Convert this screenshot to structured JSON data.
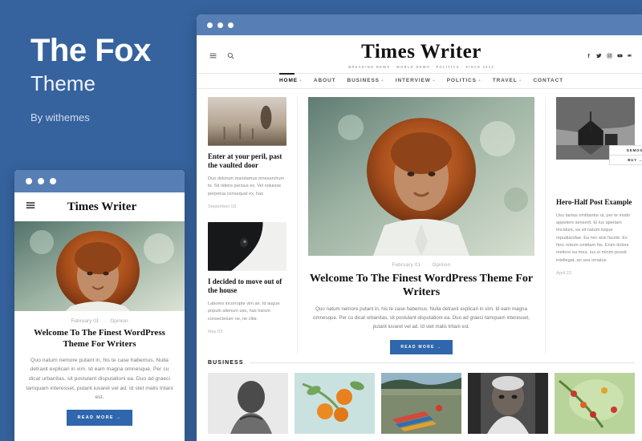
{
  "promo": {
    "title": "The Fox",
    "subtitle": "Theme",
    "author": "By withemes",
    "background_color": "#36639e"
  },
  "browser": {
    "accent_color": "#2f66ad",
    "titlebar_color": "#587fb5",
    "dots": [
      "close",
      "minimize",
      "maximize"
    ]
  },
  "site": {
    "brand": "Times Writer",
    "tagline": "BREAKING NEWS · WORLD NEWS · POLITICS · SINCE 2012",
    "header_icons": [
      {
        "name": "hamburger-menu-icon",
        "label": "Menu"
      },
      {
        "name": "search-icon",
        "label": "Search"
      }
    ],
    "socials": [
      {
        "name": "facebook-icon",
        "label": "Facebook"
      },
      {
        "name": "twitter-icon",
        "label": "Twitter"
      },
      {
        "name": "instagram-icon",
        "label": "Instagram"
      },
      {
        "name": "youtube-icon",
        "label": "YouTube"
      },
      {
        "name": "vk-icon",
        "label": "VK"
      }
    ],
    "nav": [
      {
        "label": "HOME",
        "active": true,
        "has_dropdown": true
      },
      {
        "label": "ABOUT",
        "active": false,
        "has_dropdown": false
      },
      {
        "label": "BUSINESS",
        "active": false,
        "has_dropdown": true
      },
      {
        "label": "INTERVIEW",
        "active": false,
        "has_dropdown": true
      },
      {
        "label": "POLITICS",
        "active": false,
        "has_dropdown": true
      },
      {
        "label": "TRAVEL",
        "active": false,
        "has_dropdown": true
      },
      {
        "label": "CONTACT",
        "active": false,
        "has_dropdown": false
      }
    ]
  },
  "left_column": [
    {
      "title": "Enter at your peril, past the vaulted door",
      "excerpt": "Duo dolorum mandamus mnesarchum te. Sit ridens persius ex. Vel noluisse perpetua consequat ex, has",
      "date": "September 03",
      "image_alt": "soldier-walking-field-photo"
    },
    {
      "title": "I decided to move out of the house",
      "excerpt": "Labores incorrupte vim an. Id augue populo alienum usu, has harum consectetuer ne, ne clita",
      "date": "May 03",
      "image_alt": "black-horse-portrait-photo"
    }
  ],
  "hero": {
    "date": "February 01",
    "separator": "·",
    "category": "Opinion",
    "title": "Welcome To The Finest WordPress Theme For Writers",
    "excerpt": "Quo natum nemore putant in, his te case habemus. Nulla detraxit explicari in vim. Id eam magna omnesque. Per cu dicat urbanitas, sit postulant disputationi ea. Duo ad graeci tamquam interesset, putant iuvaret vel ad. Id stet malis tritani est.",
    "read_more": "READ MORE →",
    "image_alt": "woman-curly-red-hair-portrait-photo"
  },
  "right_column": {
    "title": "Hero-Half Post Example",
    "excerpt": "Usu tantas omittantur ut, per te modo appetere senserit. Ei ius aperiam tincidunt, ea sit natum iisque repudiandae. Ea nec wisi facete. Ex hinc rebum omittam his. Enim dolore meliore ea mea. Ius ei minim possit intellegat, an sea ornatus",
    "date": "April 23",
    "image_alt": "monochrome-barn-reflection-photo"
  },
  "demos_widget": {
    "demos_label": "DEMOS",
    "buy_label": "BUY →"
  },
  "business": {
    "section_title": "BUSINESS",
    "items": [
      {
        "image_alt": "elderly-man-black-and-white-portrait"
      },
      {
        "image_alt": "oranges-on-tree-branch"
      },
      {
        "image_alt": "kayaks-on-lake-shore"
      },
      {
        "image_alt": "elderly-woman-portrait"
      },
      {
        "image_alt": "coffee-berries-on-branch"
      }
    ]
  },
  "mobile": {
    "brand": "Times Writer",
    "menu_icon": "hamburger-menu-icon",
    "meta_date": "February 01",
    "meta_separator": "·",
    "meta_category": "Opinion",
    "title": "Welcome To The Finest WordPress Theme For Writers",
    "excerpt": "Quo natum nemore putant in, his te case habemus. Nulla detraxit explicari in vim. Id eam magna omnesque. Per cu dicat urbanitas, sit postulant disputationi ea. Duo ad graeci tamquam interesset, putant iuvaret vel ad. Id stet malis tritani est.",
    "read_more": "READ MORE →",
    "image_alt": "woman-curly-red-hair-portrait-photo"
  }
}
